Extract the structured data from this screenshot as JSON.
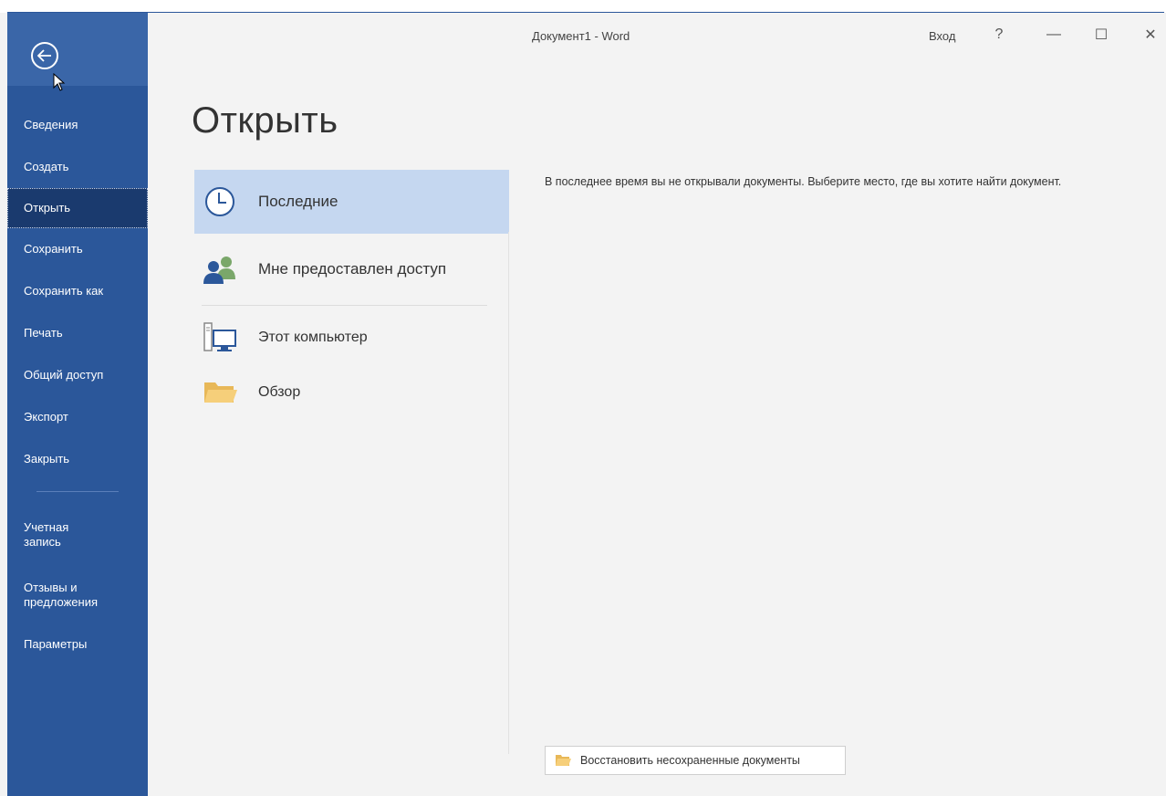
{
  "app": {
    "title": "Документ1  -  Word",
    "signin": "Вход",
    "help": "?",
    "minimize": "—",
    "maximize": "☐",
    "close": "✕"
  },
  "nav": {
    "items": [
      {
        "label": "Сведения"
      },
      {
        "label": "Создать"
      },
      {
        "label": "Открыть",
        "active": true
      },
      {
        "label": "Сохранить"
      },
      {
        "label": "Сохранить как"
      },
      {
        "label": "Печать"
      },
      {
        "label": "Общий доступ"
      },
      {
        "label": "Экспорт"
      },
      {
        "label": "Закрыть"
      }
    ],
    "bottom_items": [
      {
        "label": "Учетная запись"
      },
      {
        "label": "Отзывы и предложения"
      },
      {
        "label": "Параметры"
      }
    ]
  },
  "page": {
    "title": "Открыть",
    "locations": [
      {
        "label": "Последние",
        "icon": "clock-icon"
      },
      {
        "label": "Мне предоставлен доступ",
        "icon": "people-icon"
      },
      {
        "label": "Этот компьютер",
        "icon": "computer-icon"
      },
      {
        "label": "Обзор",
        "icon": "folder-icon"
      }
    ],
    "empty_message": "В последнее время вы не открывали документы. Выберите место, где вы хотите найти документ.",
    "recover_button": "Восстановить несохраненные документы"
  },
  "colors": {
    "nav_bg": "#2b579a",
    "nav_active": "#1a3a6e",
    "selected_location": "#c5d7f0"
  }
}
